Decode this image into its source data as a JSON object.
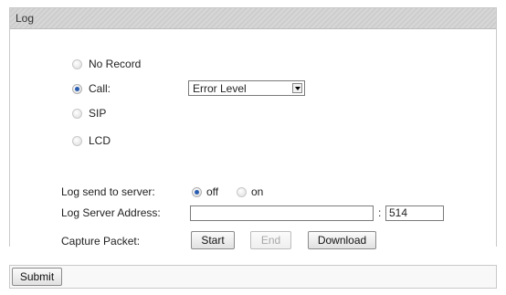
{
  "panel": {
    "title": "Log"
  },
  "log_mode": {
    "options": [
      {
        "label": "No Record",
        "selected": false
      },
      {
        "label": "Call:",
        "selected": true
      },
      {
        "label": "SIP",
        "selected": false
      },
      {
        "label": "LCD",
        "selected": false
      }
    ],
    "level_select": {
      "value": "Error Level"
    }
  },
  "server": {
    "send_label": "Log send to server:",
    "off_label": "off",
    "on_label": "on",
    "send_selected": "off",
    "address_label": "Log Server Address:",
    "address_value": "",
    "port_separator": ":",
    "port_value": "514"
  },
  "capture": {
    "label": "Capture Packet:",
    "start_label": "Start",
    "end_label": "End",
    "download_label": "Download"
  },
  "footer": {
    "submit_label": "Submit"
  },
  "colors": {
    "radio_selected": "#2a5db0",
    "header_bg": "#d3d3d3"
  }
}
